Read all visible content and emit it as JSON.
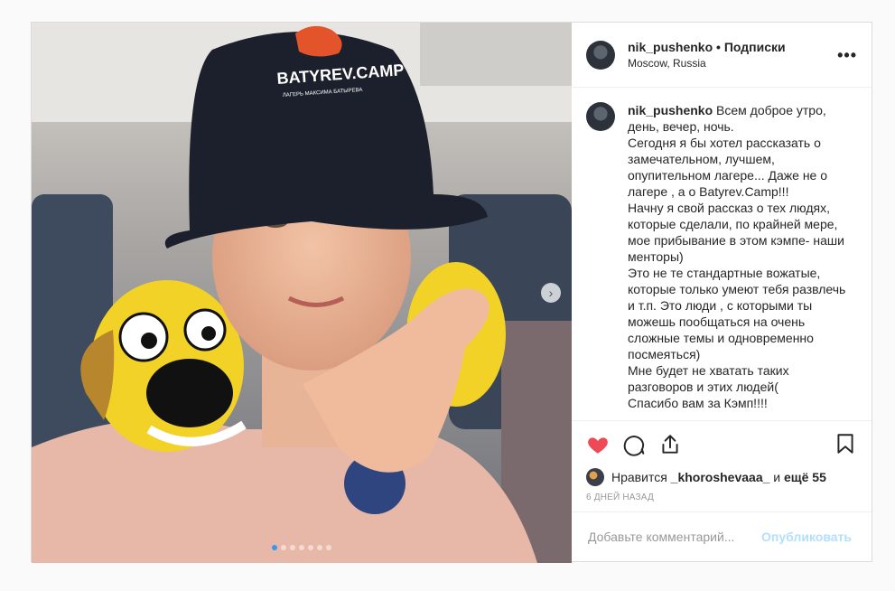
{
  "post": {
    "username": "nik_pushenko",
    "separator": "•",
    "follow_label": "Подписки",
    "location": "Moscow, Russia",
    "more_icon": "more-dots-icon",
    "caption": "Всем доброе утро, день, вечер, ночь.\nСегодня я бы хотел рассказать о замечательном, лучшем, опупительном лагере... Даже не о лагере , а о Batyrev.Camp!!!\nНачну я свой рассказ о тех людях, которые сделали, по крайней мере, мое прибывание в этом кэмпе- наши менторы)\nЭто не те стандартные вожатые, которые только умеют тебя развлечь и т.п. Это люди , с которыми ты можешь пообщаться на очень сложные темы и одновременно посмеяться)\nМне будет не хватать таких разговоров и этих людей(\nСпасибо вам за Кэмп!!!!",
    "likes_prefix": "Нравится",
    "likes_user": "_khoroshevaaa_",
    "likes_and": "и",
    "likes_more": "ещё 55",
    "time_ago": "6 ДНЕЙ НАЗАД",
    "comment_placeholder": "Добавьте комментарий...",
    "post_button": "Опубликовать",
    "carousel": {
      "slides": 7,
      "active_index": 0
    },
    "hat_text": "BATYREV.CAMP",
    "hat_subtext": "ЛАГЕРЬ МАКСИМА БАТЫРЕВА",
    "colors": {
      "like_red": "#ed4956",
      "link_blue": "#3897f0",
      "post_btn_disabled": "#b2dffc"
    }
  }
}
